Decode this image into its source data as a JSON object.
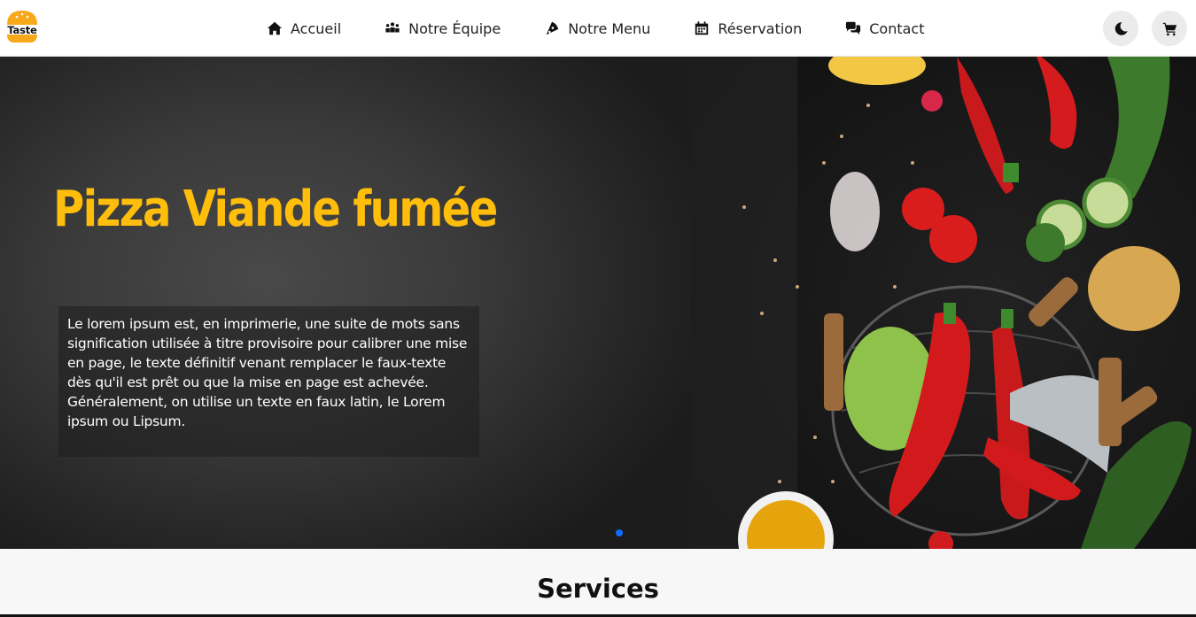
{
  "brand": {
    "logo_text": "Taste"
  },
  "nav": {
    "items": [
      {
        "label": "Accueil",
        "icon": "home-icon"
      },
      {
        "label": "Notre Équipe",
        "icon": "team-icon"
      },
      {
        "label": "Notre Menu",
        "icon": "pizza-icon"
      },
      {
        "label": "Réservation",
        "icon": "calendar-icon"
      },
      {
        "label": "Contact",
        "icon": "chat-icon"
      }
    ],
    "theme_toggle_icon": "moon-icon",
    "cart_icon": "cart-icon"
  },
  "hero": {
    "title": "Pizza Viande fumée",
    "text": "Le lorem ipsum est, en imprimerie, une suite de mots sans signification utilisée à titre provisoire pour calibrer une mise en page, le texte définitif venant remplacer le faux-texte dès qu'il est prêt ou que la mise en page est achevée. Généralement, on utilise un texte en faux latin, le Lorem ipsum ou Lipsum.",
    "active_slide": 1,
    "slide_count": 1
  },
  "services": {
    "title": "Services"
  },
  "colors": {
    "accent": "#ffbe0b",
    "dot": "#0d6efd",
    "nav_bg": "#ffffff",
    "hero_bg": "#2a2a2a"
  }
}
